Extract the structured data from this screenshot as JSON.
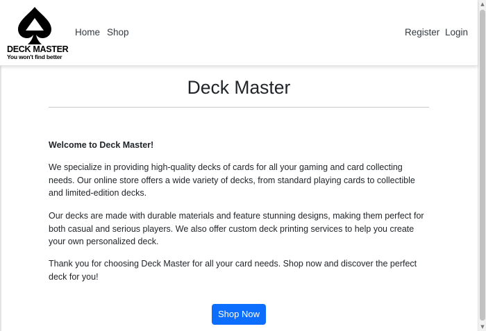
{
  "brand": {
    "name": "DECK MASTER",
    "tagline": "You won't find better"
  },
  "nav": {
    "left": [
      {
        "label": "Home"
      },
      {
        "label": "Shop"
      }
    ],
    "right": [
      {
        "label": "Register"
      },
      {
        "label": "Login"
      }
    ]
  },
  "main": {
    "title": "Deck Master",
    "welcome": "Welcome to Deck Master!",
    "paragraphs": [
      "We specialize in providing high-quality decks of cards for all your gaming and card collecting needs. Our online store offers a wide variety of decks, from standard playing cards to collectible and limited-edition decks.",
      "Our decks are made with durable materials and feature stunning designs, making them perfect for both casual and serious players. We also offer custom deck printing services to help you create your own personalized deck.",
      "Thank you for choosing Deck Master for all your card needs. Shop now and discover the perfect deck for you!"
    ],
    "cta_label": "Shop Now"
  },
  "colors": {
    "primary": "#0d6efd",
    "text": "#212529",
    "nav_link": "#333a40"
  },
  "icons": {
    "logo": "spade-icon",
    "scroll_up": "triangle-up-icon",
    "scroll_down": "triangle-down-icon"
  }
}
